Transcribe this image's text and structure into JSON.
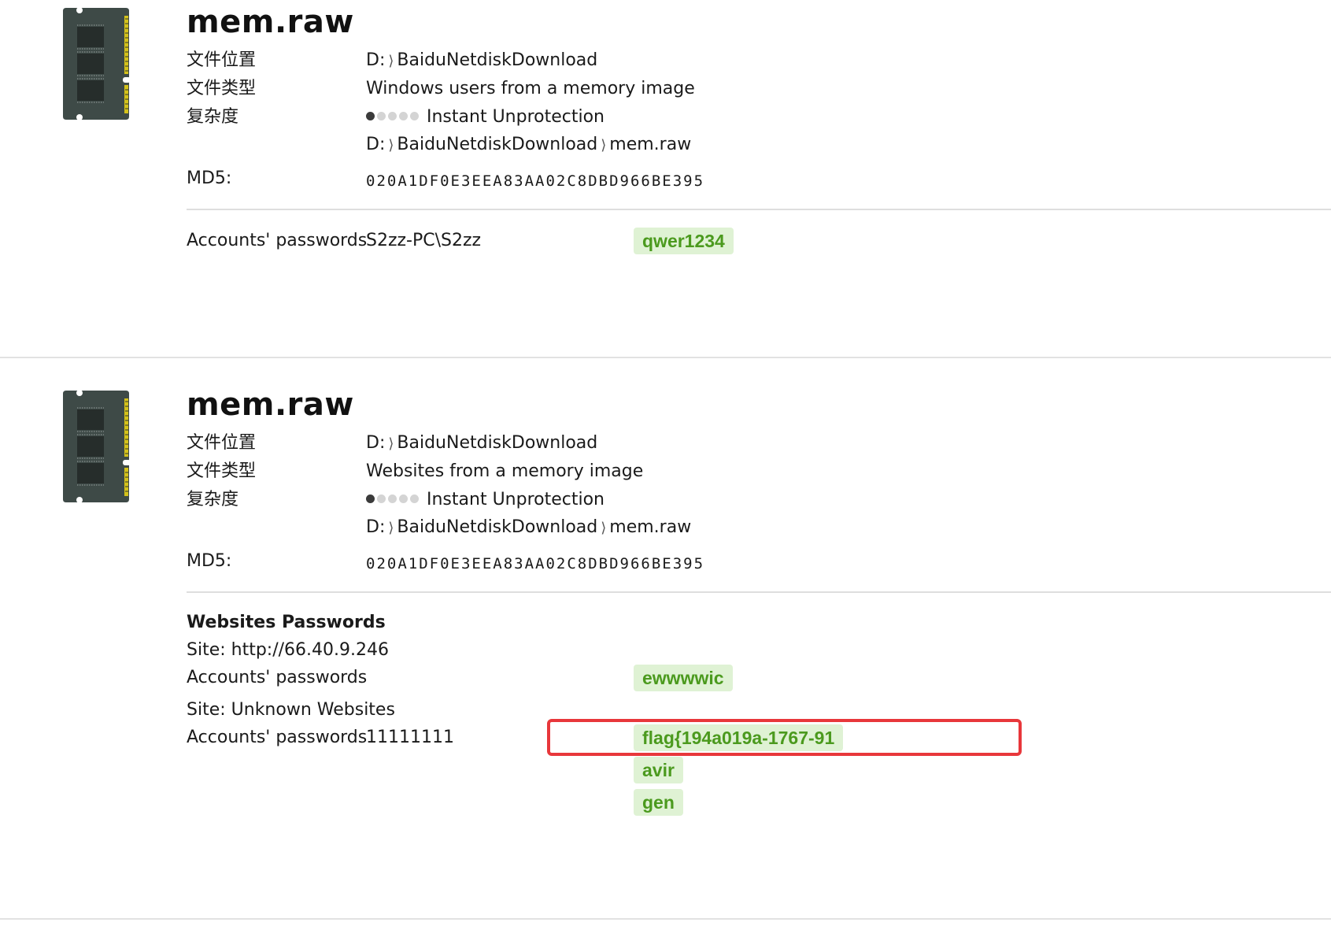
{
  "results": [
    {
      "title": "mem.raw",
      "labels": {
        "location": "文件位置",
        "type": "文件类型",
        "complexity": "复杂度",
        "md5": "MD5:"
      },
      "location": {
        "drive": "D:",
        "folder": "BaiduNetdiskDownload"
      },
      "file_type": "Windows users from a memory image",
      "complexity": {
        "level": 1,
        "max": 5,
        "text": "Instant Unprotection"
      },
      "full_path": {
        "drive": "D:",
        "folder": "BaiduNetdiskDownload",
        "file": "mem.raw"
      },
      "md5": "020A1DF0E3EEA83AA02C8DBD966BE395",
      "accounts": [
        {
          "label": "Accounts' passwords",
          "user": "S2zz-PC\\S2zz",
          "passwords": [
            "qwer1234"
          ]
        }
      ]
    },
    {
      "title": "mem.raw",
      "labels": {
        "location": "文件位置",
        "type": "文件类型",
        "complexity": "复杂度",
        "md5": "MD5:"
      },
      "location": {
        "drive": "D:",
        "folder": "BaiduNetdiskDownload"
      },
      "file_type": "Websites from a memory image",
      "complexity": {
        "level": 1,
        "max": 5,
        "text": "Instant Unprotection"
      },
      "full_path": {
        "drive": "D:",
        "folder": "BaiduNetdiskDownload",
        "file": "mem.raw"
      },
      "md5": "020A1DF0E3EEA83AA02C8DBD966BE395",
      "section_heading": "Websites Passwords",
      "sites": [
        {
          "site": "Site: http://66.40.9.246",
          "label": "Accounts' passwords",
          "user": "",
          "passwords": [
            "ewwwwic"
          ]
        },
        {
          "site": "Site: Unknown Websites",
          "label": "Accounts' passwords",
          "user": "11111111",
          "passwords": [
            "flag{194a019a-1767-91",
            "avir",
            "gen"
          ]
        }
      ]
    }
  ],
  "colors": {
    "password_badge_bg": "#dff2d4",
    "password_badge_text": "#4b9a1e",
    "highlight_border": "#e8373b",
    "ram_body": "#3e4a47",
    "ram_contacts": "#d4c21a"
  },
  "icons": {
    "file_icon": "ram-memory-module-icon"
  }
}
